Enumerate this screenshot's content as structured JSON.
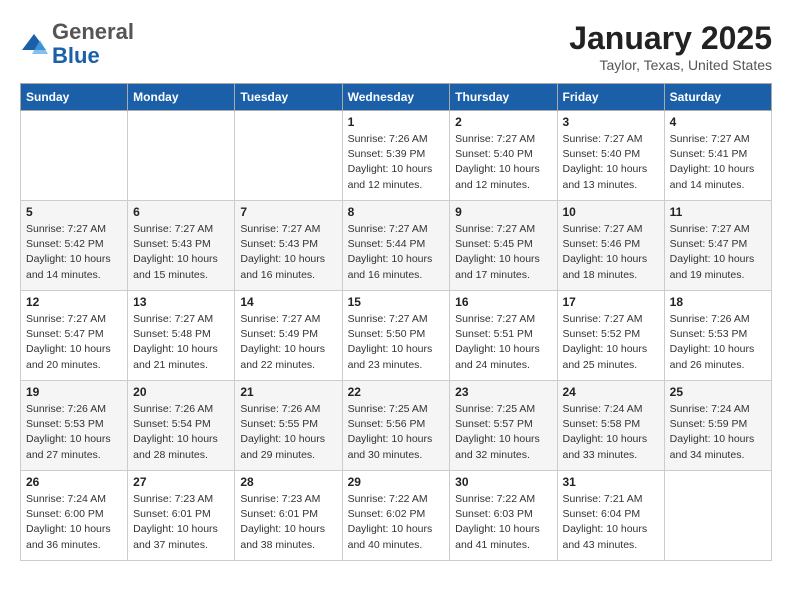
{
  "header": {
    "logo_line1": "General",
    "logo_line2": "Blue",
    "month": "January 2025",
    "location": "Taylor, Texas, United States"
  },
  "weekdays": [
    "Sunday",
    "Monday",
    "Tuesday",
    "Wednesday",
    "Thursday",
    "Friday",
    "Saturday"
  ],
  "weeks": [
    [
      {
        "day": "",
        "info": ""
      },
      {
        "day": "",
        "info": ""
      },
      {
        "day": "",
        "info": ""
      },
      {
        "day": "1",
        "info": "Sunrise: 7:26 AM\nSunset: 5:39 PM\nDaylight: 10 hours\nand 12 minutes."
      },
      {
        "day": "2",
        "info": "Sunrise: 7:27 AM\nSunset: 5:40 PM\nDaylight: 10 hours\nand 12 minutes."
      },
      {
        "day": "3",
        "info": "Sunrise: 7:27 AM\nSunset: 5:40 PM\nDaylight: 10 hours\nand 13 minutes."
      },
      {
        "day": "4",
        "info": "Sunrise: 7:27 AM\nSunset: 5:41 PM\nDaylight: 10 hours\nand 14 minutes."
      }
    ],
    [
      {
        "day": "5",
        "info": "Sunrise: 7:27 AM\nSunset: 5:42 PM\nDaylight: 10 hours\nand 14 minutes."
      },
      {
        "day": "6",
        "info": "Sunrise: 7:27 AM\nSunset: 5:43 PM\nDaylight: 10 hours\nand 15 minutes."
      },
      {
        "day": "7",
        "info": "Sunrise: 7:27 AM\nSunset: 5:43 PM\nDaylight: 10 hours\nand 16 minutes."
      },
      {
        "day": "8",
        "info": "Sunrise: 7:27 AM\nSunset: 5:44 PM\nDaylight: 10 hours\nand 16 minutes."
      },
      {
        "day": "9",
        "info": "Sunrise: 7:27 AM\nSunset: 5:45 PM\nDaylight: 10 hours\nand 17 minutes."
      },
      {
        "day": "10",
        "info": "Sunrise: 7:27 AM\nSunset: 5:46 PM\nDaylight: 10 hours\nand 18 minutes."
      },
      {
        "day": "11",
        "info": "Sunrise: 7:27 AM\nSunset: 5:47 PM\nDaylight: 10 hours\nand 19 minutes."
      }
    ],
    [
      {
        "day": "12",
        "info": "Sunrise: 7:27 AM\nSunset: 5:47 PM\nDaylight: 10 hours\nand 20 minutes."
      },
      {
        "day": "13",
        "info": "Sunrise: 7:27 AM\nSunset: 5:48 PM\nDaylight: 10 hours\nand 21 minutes."
      },
      {
        "day": "14",
        "info": "Sunrise: 7:27 AM\nSunset: 5:49 PM\nDaylight: 10 hours\nand 22 minutes."
      },
      {
        "day": "15",
        "info": "Sunrise: 7:27 AM\nSunset: 5:50 PM\nDaylight: 10 hours\nand 23 minutes."
      },
      {
        "day": "16",
        "info": "Sunrise: 7:27 AM\nSunset: 5:51 PM\nDaylight: 10 hours\nand 24 minutes."
      },
      {
        "day": "17",
        "info": "Sunrise: 7:27 AM\nSunset: 5:52 PM\nDaylight: 10 hours\nand 25 minutes."
      },
      {
        "day": "18",
        "info": "Sunrise: 7:26 AM\nSunset: 5:53 PM\nDaylight: 10 hours\nand 26 minutes."
      }
    ],
    [
      {
        "day": "19",
        "info": "Sunrise: 7:26 AM\nSunset: 5:53 PM\nDaylight: 10 hours\nand 27 minutes."
      },
      {
        "day": "20",
        "info": "Sunrise: 7:26 AM\nSunset: 5:54 PM\nDaylight: 10 hours\nand 28 minutes."
      },
      {
        "day": "21",
        "info": "Sunrise: 7:26 AM\nSunset: 5:55 PM\nDaylight: 10 hours\nand 29 minutes."
      },
      {
        "day": "22",
        "info": "Sunrise: 7:25 AM\nSunset: 5:56 PM\nDaylight: 10 hours\nand 30 minutes."
      },
      {
        "day": "23",
        "info": "Sunrise: 7:25 AM\nSunset: 5:57 PM\nDaylight: 10 hours\nand 32 minutes."
      },
      {
        "day": "24",
        "info": "Sunrise: 7:24 AM\nSunset: 5:58 PM\nDaylight: 10 hours\nand 33 minutes."
      },
      {
        "day": "25",
        "info": "Sunrise: 7:24 AM\nSunset: 5:59 PM\nDaylight: 10 hours\nand 34 minutes."
      }
    ],
    [
      {
        "day": "26",
        "info": "Sunrise: 7:24 AM\nSunset: 6:00 PM\nDaylight: 10 hours\nand 36 minutes."
      },
      {
        "day": "27",
        "info": "Sunrise: 7:23 AM\nSunset: 6:01 PM\nDaylight: 10 hours\nand 37 minutes."
      },
      {
        "day": "28",
        "info": "Sunrise: 7:23 AM\nSunset: 6:01 PM\nDaylight: 10 hours\nand 38 minutes."
      },
      {
        "day": "29",
        "info": "Sunrise: 7:22 AM\nSunset: 6:02 PM\nDaylight: 10 hours\nand 40 minutes."
      },
      {
        "day": "30",
        "info": "Sunrise: 7:22 AM\nSunset: 6:03 PM\nDaylight: 10 hours\nand 41 minutes."
      },
      {
        "day": "31",
        "info": "Sunrise: 7:21 AM\nSunset: 6:04 PM\nDaylight: 10 hours\nand 43 minutes."
      },
      {
        "day": "",
        "info": ""
      }
    ]
  ]
}
